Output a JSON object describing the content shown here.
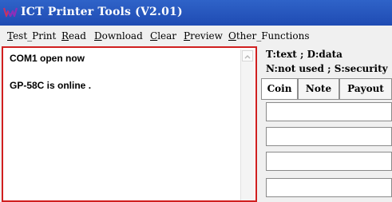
{
  "window": {
    "title": "ICT Printer Tools (V2.01)"
  },
  "menu": {
    "items": [
      {
        "mnemonic": "T",
        "rest": "est_Print"
      },
      {
        "mnemonic": "R",
        "rest": "ead"
      },
      {
        "mnemonic": "D",
        "rest": "ownload"
      },
      {
        "mnemonic": "C",
        "rest": "lear"
      },
      {
        "mnemonic": "P",
        "rest": "review"
      },
      {
        "mnemonic": "O",
        "rest": "ther_Functions"
      }
    ]
  },
  "log": {
    "lines": [
      "COM1  open now",
      "GP-58C is online ."
    ]
  },
  "legend": {
    "line1": "T:text ; D:data",
    "line2": "N:not used ; S:security"
  },
  "tabs": [
    {
      "label": "Coin",
      "active": true
    },
    {
      "label": "Note",
      "active": false
    },
    {
      "label": "Payout",
      "active": false
    }
  ],
  "fields": [
    {
      "value": ""
    },
    {
      "value": ""
    },
    {
      "value": ""
    },
    {
      "value": ""
    }
  ],
  "colors": {
    "titlebar": "#1f4bb3",
    "log_border": "#d01f1f"
  }
}
